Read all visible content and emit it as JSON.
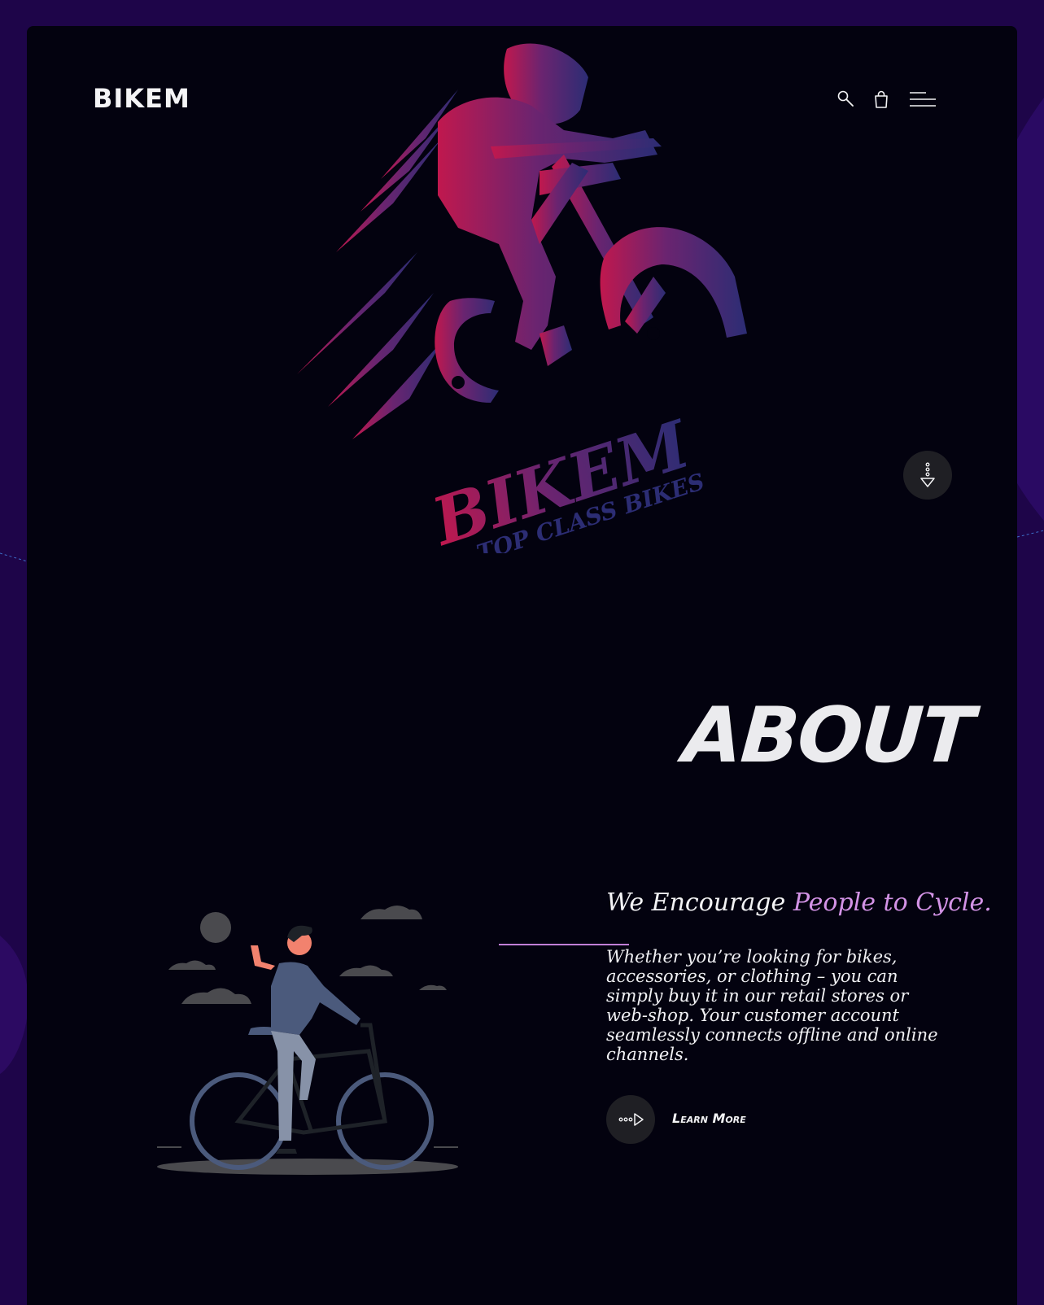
{
  "brand": {
    "name": "BIKEM"
  },
  "hero": {
    "logo_word": "BIKEM",
    "logo_sub": "TOP CLASS BIKES"
  },
  "nav": {
    "icons": [
      "search-icon",
      "bag-icon",
      "menu-icon"
    ]
  },
  "about": {
    "heading": "ABOUT",
    "tagline_plain": "We Encourage ",
    "tagline_accent": "People to Cycle.",
    "paragraph": "Whether you’re looking for bikes, accessories, or clothing – you can simply buy it in our retail stores or web-shop. Your customer account seamlessly connects offline and online channels.",
    "learn_more": "Learn More"
  },
  "colors": {
    "page_bg": "#1e0549",
    "card_bg": "#03020f",
    "accent": "#d393e6",
    "logo_gradient_start": "#c0184e",
    "logo_gradient_end": "#2c2d74"
  }
}
